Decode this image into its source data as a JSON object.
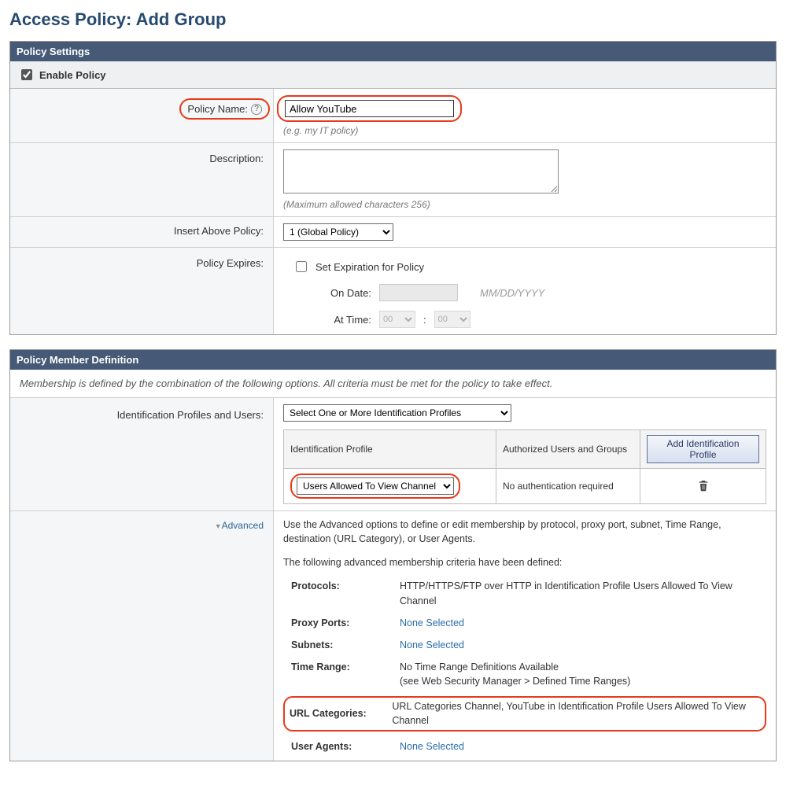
{
  "page_title": "Access Policy: Add Group",
  "policy_settings": {
    "header": "Policy Settings",
    "enable_label": "Enable Policy",
    "enable_checked": true,
    "policy_name_label": "Policy Name:",
    "policy_name_value": "Allow YouTube",
    "policy_name_hint": "(e.g. my IT policy)",
    "description_label": "Description:",
    "description_value": "",
    "description_hint": "(Maximum allowed characters 256)",
    "insert_above_label": "Insert Above Policy:",
    "insert_above_selected": "1 (Global Policy)",
    "policy_expires_label": "Policy Expires:",
    "set_expiration_label": "Set Expiration for Policy",
    "on_date_label": "On Date:",
    "date_format_hint": "MM/DD/YYYY",
    "at_time_label": "At Time:",
    "time_hh": "00",
    "time_mm": "00"
  },
  "member_def": {
    "header": "Policy Member Definition",
    "description": "Membership is defined by the combination of the following options. All criteria must be met for the policy to take effect.",
    "idprof_label": "Identification Profiles and Users:",
    "idprof_select_value": "Select One or More Identification Profiles",
    "table_headers": {
      "profile": "Identification Profile",
      "auth": "Authorized Users and Groups",
      "add_btn": "Add Identification Profile"
    },
    "table_row": {
      "profile_selected": "Users Allowed To View Channel",
      "auth_text": "No authentication required"
    },
    "advanced_label": "Advanced",
    "adv_intro": "Use the Advanced options to define or edit membership by protocol, proxy port, subnet, Time Range, destination (URL Category), or User Agents.",
    "adv_defined_intro": "The following advanced membership criteria have been defined:",
    "adv": {
      "protocols_k": "Protocols:",
      "protocols_v": "HTTP/HTTPS/FTP over HTTP in Identification Profile Users Allowed To View Channel",
      "proxy_ports_k": "Proxy Ports:",
      "proxy_ports_v": "None Selected",
      "subnets_k": "Subnets:",
      "subnets_v": "None Selected",
      "time_range_k": "Time Range:",
      "time_range_v1": "No Time Range Definitions Available",
      "time_range_v2": "(see Web Security Manager > Defined Time Ranges)",
      "url_cat_k": "URL Categories:",
      "url_cat_v": "URL Categories Channel, YouTube in Identification Profile Users Allowed To View Channel",
      "user_agents_k": "User Agents:",
      "user_agents_v": "None Selected"
    }
  }
}
